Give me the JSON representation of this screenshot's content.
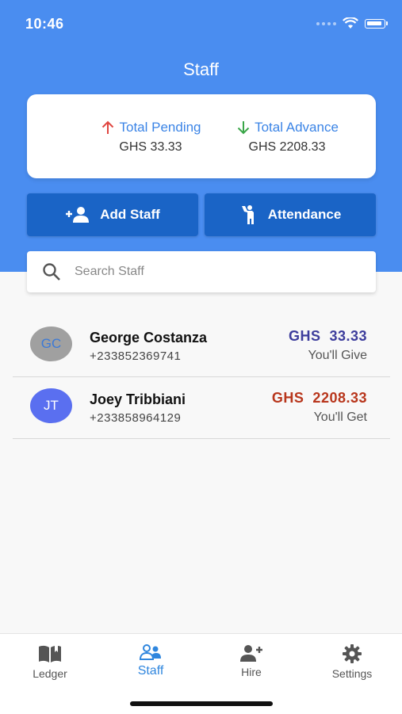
{
  "status": {
    "time": "10:46"
  },
  "header": {
    "title": "Staff"
  },
  "summary": {
    "pending_label": "Total Pending",
    "pending_value": "GHS 33.33",
    "advance_label": "Total Advance",
    "advance_value": "GHS 2208.33",
    "pending_color": "#e0453f",
    "advance_color": "#3aa648"
  },
  "actions": {
    "add_staff": "Add Staff",
    "attendance": "Attendance"
  },
  "search": {
    "placeholder": "Search Staff",
    "value": ""
  },
  "staff": [
    {
      "initials": "GC",
      "name": "George Costanza",
      "phone": "+233852369741",
      "amount": "GHS  33.33",
      "label": "You'll Give",
      "amount_color": "#3d3d9c",
      "avatar_bg": "#a0a0a0",
      "avatar_fg": "#3d7ad6"
    },
    {
      "initials": "JT",
      "name": "Joey Tribbiani",
      "phone": "+233858964129",
      "amount": "GHS  2208.33",
      "label": "You'll Get",
      "amount_color": "#b8361c",
      "avatar_bg": "#5a6ff0",
      "avatar_fg": "#ffffff"
    }
  ],
  "tabs": [
    {
      "label": "Ledger",
      "icon": "book-open-icon"
    },
    {
      "label": "Staff",
      "icon": "people-icon",
      "active": true
    },
    {
      "label": "Hire",
      "icon": "add-person-icon"
    },
    {
      "label": "Settings",
      "icon": "gear-icon"
    }
  ],
  "colors": {
    "primary": "#4a8df0",
    "button": "#1a64c6",
    "active_tab": "#2f86de"
  }
}
